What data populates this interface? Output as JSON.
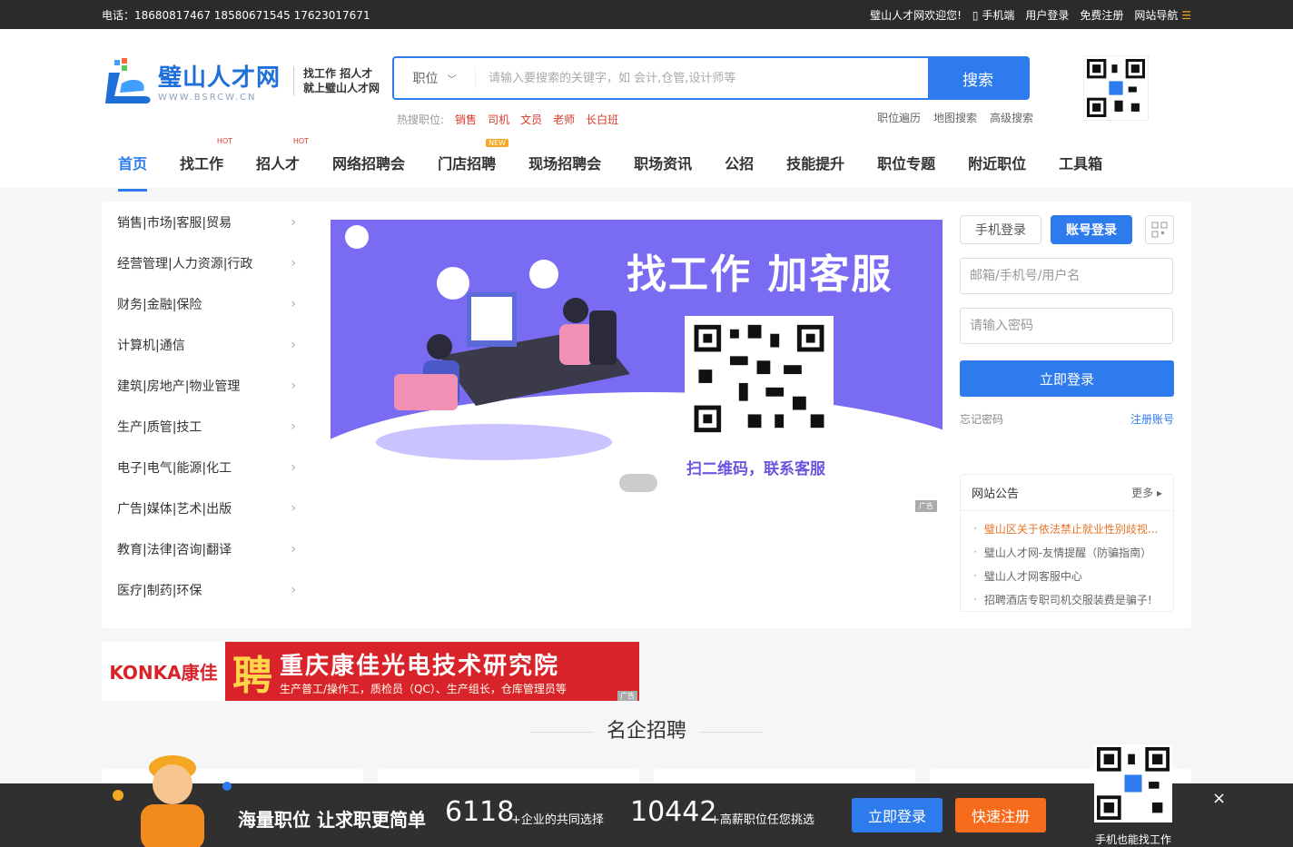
{
  "topbar": {
    "phone": "电话：18680817467 18580671545 17623017671",
    "welcome": "璧山人才网欢迎您!",
    "mobile": "手机端",
    "login": "用户登录",
    "register": "免费注册",
    "sitenav": "网站导航"
  },
  "logo": {
    "cn": "璧山人才网",
    "en": "WWW.BSRCW.CN",
    "slogan1": "找工作  招人才",
    "slogan2": "就上璧山人才网"
  },
  "search": {
    "type": "职位",
    "placeholder": "请输入要搜索的关键字，如 会计,仓管,设计师等",
    "button": "搜索"
  },
  "hot": {
    "label": "热搜职位:",
    "keys": [
      "销售",
      "司机",
      "文员",
      "老师",
      "长白班"
    ]
  },
  "adv": [
    "职位遍历",
    "地图搜索",
    "高级搜索"
  ],
  "nav": [
    {
      "label": "首页",
      "tag": ""
    },
    {
      "label": "找工作",
      "tag": "HOT"
    },
    {
      "label": "招人才",
      "tag": "HOT"
    },
    {
      "label": "网络招聘会",
      "tag": ""
    },
    {
      "label": "门店招聘",
      "tag": "NEW"
    },
    {
      "label": "现场招聘会",
      "tag": ""
    },
    {
      "label": "职场资讯",
      "tag": ""
    },
    {
      "label": "公招",
      "tag": ""
    },
    {
      "label": "技能提升",
      "tag": ""
    },
    {
      "label": "职位专题",
      "tag": ""
    },
    {
      "label": "附近职位",
      "tag": ""
    },
    {
      "label": "工具箱",
      "tag": ""
    }
  ],
  "categories": [
    "销售|市场|客服|贸易",
    "经营管理|人力资源|行政",
    "财务|金融|保险",
    "计算机|通信",
    "建筑|房地产|物业管理",
    "生产|质管|技工",
    "电子|电气|能源|化工",
    "广告|媒体|艺术|出版",
    "教育|法律|咨询|翻译",
    "医疗|制药|环保"
  ],
  "banner": {
    "title": "找工作 加客服",
    "caption": "扫二维码，联系客服",
    "ad": "广告"
  },
  "login": {
    "tab_phone": "手机登录",
    "tab_account": "账号登录",
    "user_placeholder": "邮箱/手机号/用户名",
    "pass_placeholder": "请输入密码",
    "button": "立即登录",
    "forgot": "忘记密码",
    "register": "注册账号"
  },
  "notice": {
    "title": "网站公告",
    "more": "更多",
    "items": [
      "璧山区关于依法禁止就业性别歧视...",
      "璧山人才网-友情提醒（防骗指南）",
      "璧山人才网客服中心",
      "招聘酒店专职司机交服装费是骗子!"
    ]
  },
  "konka": {
    "logo": "KONKA康佳",
    "pin": "聘",
    "title": "重庆康佳光电技术研究院",
    "sub": "生产普工/操作工，质检员（QC）、生产组长，仓库管理员等",
    "ad": "广告"
  },
  "section": {
    "title": "名企招聘"
  },
  "float_qr": {
    "caption": "手机也能找工作"
  },
  "bottom": {
    "slogan": "海量职位 让求职更简单",
    "n1": "6118",
    "s1": "+企业的共同选择",
    "n2": "10442",
    "s2": "+高薪职位任您挑选",
    "btn_login": "立即登录",
    "btn_reg": "快速注册",
    "close": "×"
  },
  "colors": {
    "primary": "#2d7bec",
    "accent": "#f76b1c",
    "hot": "#d93a2b",
    "banner": "#7a6cf2"
  }
}
